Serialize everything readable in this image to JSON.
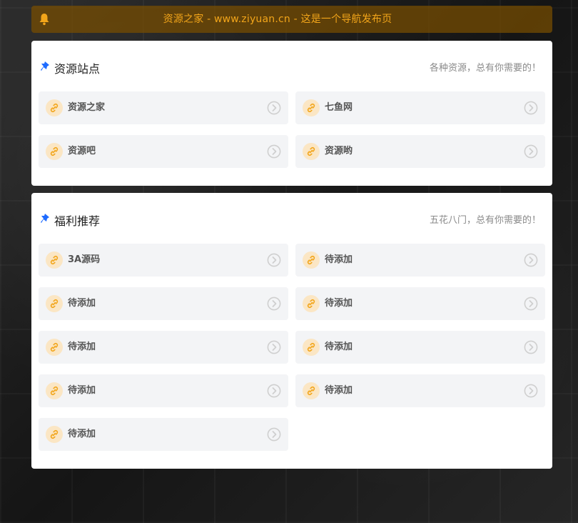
{
  "notice": {
    "text": "资源之家 - www.ziyuan.cn - 这是一个导航发布页",
    "icon": "bell-icon",
    "text_color": "#f2a51a"
  },
  "sections": [
    {
      "title": "资源站点",
      "tagline": "各种资源，总有你需要的！",
      "items": [
        {
          "label": "资源之家"
        },
        {
          "label": "七鱼网"
        },
        {
          "label": "资源吧"
        },
        {
          "label": "资源哟"
        }
      ]
    },
    {
      "title": "福利推荐",
      "tagline": "五花八门，总有你需要的！",
      "items": [
        {
          "label": "3A源码"
        },
        {
          "label": "待添加"
        },
        {
          "label": "待添加"
        },
        {
          "label": "待添加"
        },
        {
          "label": "待添加"
        },
        {
          "label": "待添加"
        },
        {
          "label": "待添加"
        },
        {
          "label": "待添加"
        },
        {
          "label": "待添加"
        }
      ]
    }
  ],
  "icons": {
    "section": "pin-icon",
    "item": "link-icon",
    "item_arrow": "chevron-right-circle-icon"
  },
  "colors": {
    "accent": "#f2a51a",
    "pin": "#1e6bff",
    "card_bg": "#ffffff",
    "item_bg": "#f3f4f6"
  }
}
